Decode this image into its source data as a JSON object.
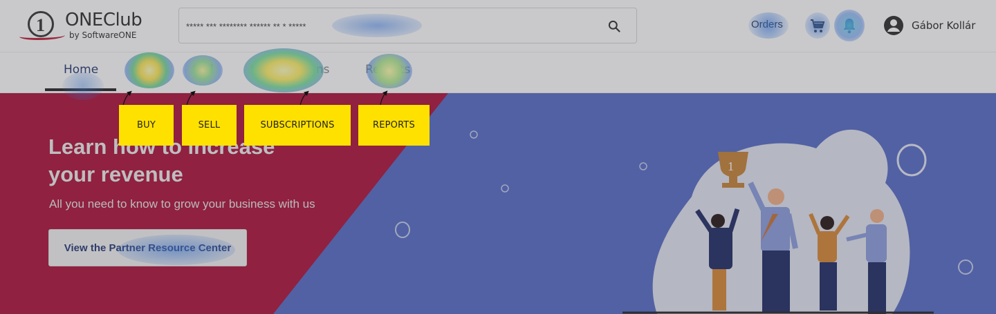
{
  "header": {
    "logo_title": "ONEClub",
    "logo_sub": "by SoftwareONE",
    "logo_mark_text": "1",
    "search_value": "***** *** ******** ****** ** * *****",
    "orders_label": "Orders",
    "user_name": "Gábor Kollár"
  },
  "nav": {
    "items": [
      {
        "label": "Home",
        "active": true
      },
      {
        "label": "Buy"
      },
      {
        "label": "Sell"
      },
      {
        "label": "Subscriptions"
      },
      {
        "label": "Reports"
      }
    ]
  },
  "hero": {
    "title_line1": "Learn how to increase",
    "title_line2": "your revenue",
    "subtitle": "All you need to know to grow your business with us",
    "button_label": "View the Partner Resource Center"
  },
  "annotations": {
    "labels": [
      "BUY",
      "SELL",
      "SUBSCRIPTIONS",
      "REPORTS"
    ],
    "color": "#ffe100"
  },
  "colors": {
    "brand_red": "#c01f3c",
    "hero_blue": "#5a6fc8",
    "nav_active": "#2a3d7a"
  },
  "icons": [
    "search-icon",
    "cart-icon",
    "bell-icon",
    "user-avatar-icon",
    "trophy-icon"
  ]
}
